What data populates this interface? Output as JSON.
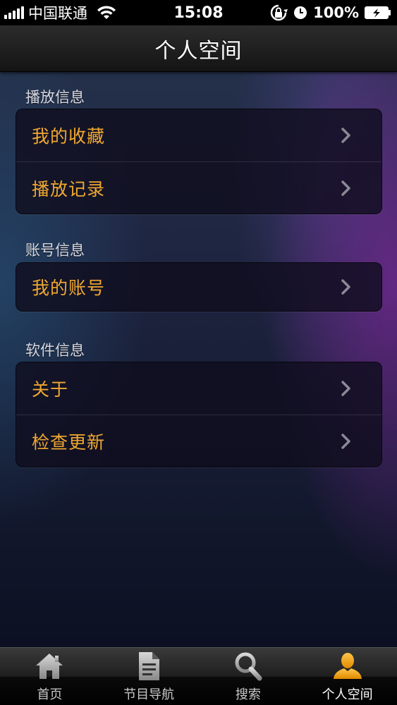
{
  "status_bar": {
    "carrier": "中国联通",
    "time": "15:08",
    "battery": "100%"
  },
  "navbar": {
    "title": "个人空间"
  },
  "sections": [
    {
      "title": "播放信息",
      "items": [
        {
          "label": "我的收藏"
        },
        {
          "label": "播放记录"
        }
      ]
    },
    {
      "title": "账号信息",
      "items": [
        {
          "label": "我的账号"
        }
      ]
    },
    {
      "title": "软件信息",
      "items": [
        {
          "label": "关于"
        },
        {
          "label": "检查更新"
        }
      ]
    }
  ],
  "tabbar": {
    "tabs": [
      {
        "label": "首页",
        "icon": "home-icon"
      },
      {
        "label": "节目导航",
        "icon": "document-icon"
      },
      {
        "label": "搜索",
        "icon": "search-icon"
      },
      {
        "label": "个人空间",
        "icon": "person-icon"
      }
    ],
    "active_tab": "个人空间"
  },
  "colors": {
    "item_label": "#f0a830",
    "active_tab_icon": "#f5a623"
  }
}
